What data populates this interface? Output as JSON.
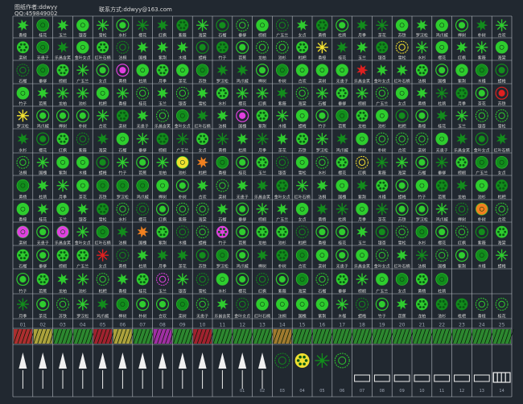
{
  "header": {
    "author_label": "图纸作者:ddwyy",
    "qq_label": "QQ:459849002",
    "contact_label": "联系方式:ddwyy@163.com"
  },
  "colors": {
    "background": "#212830",
    "grid_line": "#b8bcc4",
    "label_text": "#d8d8d8",
    "plant_green": "#2ecc2e",
    "plant_dark_green": "#128c1c",
    "accent_magenta": "#e040e0",
    "accent_yellow": "#f0e030",
    "accent_orange": "#f08020",
    "accent_red": "#e02020",
    "symbol_white": "#f0f0f0",
    "number_text": "#a0a8b8"
  },
  "plant_labels": [
    "香樟",
    "桂花",
    "玉兰",
    "银杏",
    "雪松",
    "水杉",
    "樱花",
    "红枫",
    "紫薇",
    "海棠",
    "石榴",
    "垂柳",
    "棕榈",
    "广玉兰",
    "女贞",
    "黄杨",
    "杜鹃",
    "月季",
    "茶花",
    "苏铁",
    "罗汉松",
    "鸡爪槭",
    "榉树",
    "朴树",
    "合欢",
    "栾树",
    "无患子",
    "乐昌含笑",
    "金叶女贞",
    "红叶石楠",
    "法桐",
    "国槐",
    "紫荆",
    "木槿",
    "蜡梅",
    "竹子",
    "芭蕉",
    "龙柏",
    "池杉",
    "枇杷"
  ],
  "swatch_numbers": [
    "01",
    "02",
    "03",
    "04",
    "05",
    "06",
    "07",
    "08",
    "09",
    "10",
    "11",
    "12",
    "13",
    "14",
    "15",
    "16",
    "17",
    "18",
    "19",
    "20",
    "21",
    "22",
    "23",
    "24",
    "25"
  ],
  "bottom_numbers": [
    "01",
    "02",
    "03",
    "04",
    "05",
    "06",
    "07",
    "08",
    "09",
    "10",
    "11",
    "12",
    "13",
    "14"
  ],
  "icons": {
    "plant_symbol": "plant-symbol-icon",
    "compass_arrow": "north-arrow-icon",
    "hatch_swatch": "hatch-pattern-icon",
    "scale_bar": "scale-bar-icon"
  }
}
